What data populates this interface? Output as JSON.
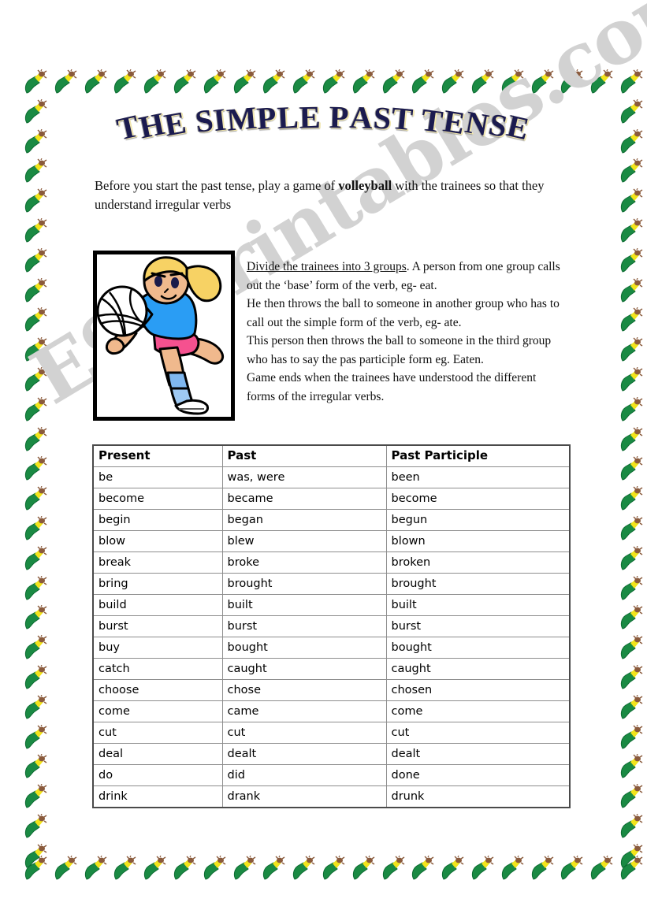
{
  "title": {
    "text": "THE SIMPLE PAST TENSE",
    "fill_color": "#1b1b4f",
    "outline_color": "#f2e9b8"
  },
  "intro": {
    "before": "Before you start the past tense, play a game of ",
    "bold": "volleyball",
    "after": " with the trainees so that they understand irregular verbs"
  },
  "illustration": {
    "name": "volleyball-player-clipart",
    "description": "Cartoon blonde girl bumping a volleyball",
    "shirt_color": "#2a9df4",
    "shorts_color": "#f5518f",
    "hair_color": "#f7d264",
    "skin_color": "#f0b98d",
    "socks_color": "#7fb7ef",
    "ball_color": "#ffffff"
  },
  "game_instructions": {
    "underlined_lead": "Divide the trainees into 3 groups",
    "lines": [
      ". A person from one group calls out the ‘base’ form of the verb, eg- eat.",
      " He then throws the ball to someone in another group who has to call out the simple form of the verb, eg- ate.",
      "This person then throws the ball to someone in the third group who has to say the pas participle form eg. Eaten.",
      "Game ends when the trainees have understood the different forms of the irregular verbs."
    ]
  },
  "verb_table": {
    "headers": [
      "Present",
      "Past",
      "Past Participle"
    ],
    "rows": [
      [
        "be",
        "was, were",
        "been"
      ],
      [
        "become",
        "became",
        "become"
      ],
      [
        "begin",
        "began",
        "begun"
      ],
      [
        "blow",
        "blew",
        "blown"
      ],
      [
        "break",
        "broke",
        "broken"
      ],
      [
        "bring",
        "brought",
        "brought"
      ],
      [
        "build",
        "built",
        "built"
      ],
      [
        "burst",
        "burst",
        "burst"
      ],
      [
        "buy",
        "bought",
        "bought"
      ],
      [
        "catch",
        "caught",
        "caught"
      ],
      [
        "choose",
        "chose",
        "chosen"
      ],
      [
        "come",
        "came",
        "come"
      ],
      [
        "cut",
        "cut",
        "cut"
      ],
      [
        "deal",
        "dealt",
        "dealt"
      ],
      [
        "do",
        "did",
        "done"
      ],
      [
        "drink",
        "drank",
        "drunk"
      ]
    ]
  },
  "watermark": {
    "text": "ESLprintables.com",
    "color": "#d2d2d2"
  },
  "page_border": {
    "motif_name": "champagne-bottle-popping",
    "bottle_color": "#1a8a43",
    "neck_color": "#f2e41c",
    "cork_color": "#8a5a3c"
  }
}
